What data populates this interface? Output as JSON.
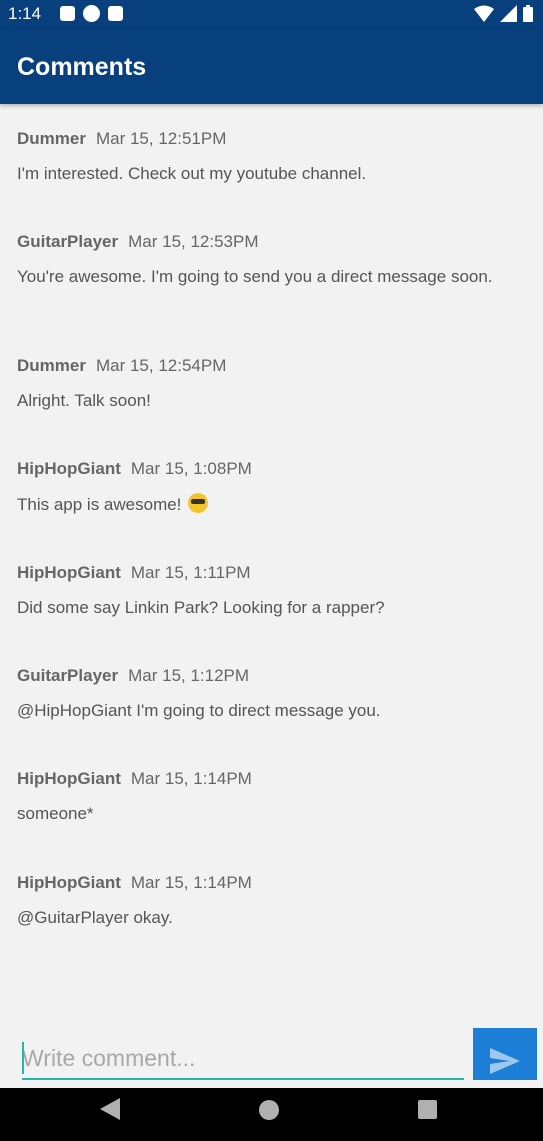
{
  "status_bar": {
    "time": "1:14"
  },
  "header": {
    "title": "Comments"
  },
  "comments": [
    {
      "user": "Dummer",
      "time": "Mar 15, 12:51PM",
      "text": "I'm interested. Check out my youtube channel."
    },
    {
      "user": "GuitarPlayer",
      "time": "Mar 15, 12:53PM",
      "text": "You're awesome. I'm going to send you a direct message soon."
    },
    {
      "user": "Dummer",
      "time": "Mar 15, 12:54PM",
      "text": "Alright. Talk soon!"
    },
    {
      "user": "HipHopGiant",
      "time": "Mar 15, 1:08PM",
      "text": "This app is awesome!"
    },
    {
      "user": "HipHopGiant",
      "time": "Mar 15, 1:11PM",
      "text": "Did some say Linkin Park? Looking for a rapper?"
    },
    {
      "user": "GuitarPlayer",
      "time": "Mar 15, 1:12PM",
      "text": "@HipHopGiant I'm going to direct message you."
    },
    {
      "user": "HipHopGiant",
      "time": "Mar 15, 1:14PM",
      "text": "someone*"
    },
    {
      "user": "HipHopGiant",
      "time": "Mar 15, 1:14PM",
      "text": "@GuitarPlayer okay."
    }
  ],
  "composer": {
    "placeholder": "Write comment..."
  },
  "colors": {
    "app_bar": "#07407c",
    "send_button": "#1c7ed6",
    "input_underline": "#24b8a8"
  }
}
